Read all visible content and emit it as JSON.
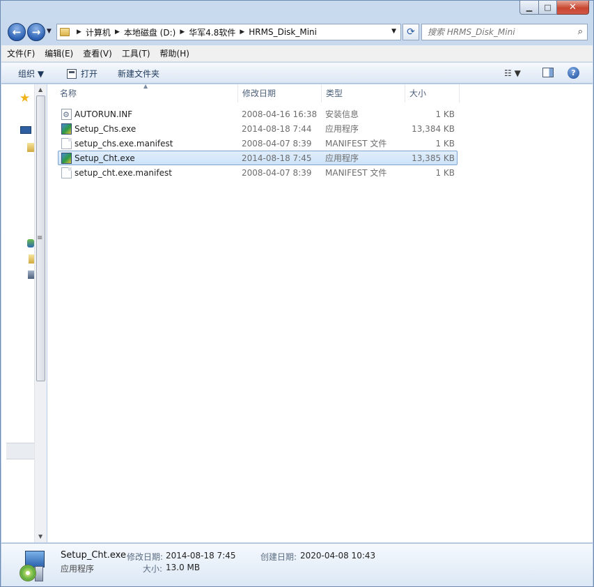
{
  "window": {
    "controls": {
      "minimize": "▁",
      "maximize": "□",
      "close": "✕"
    }
  },
  "navigation": {
    "back_icon": "←",
    "forward_icon": "→",
    "history_dropdown": "▼",
    "breadcrumb": [
      "计算机",
      "本地磁盘 (D:)",
      "华军4.8软件",
      "HRMS_Disk_Mini"
    ],
    "refresh_icon": "⟳",
    "search_placeholder": "搜索 HRMS_Disk_Mini"
  },
  "menubar": {
    "items": [
      "文件(F)",
      "编辑(E)",
      "查看(V)",
      "工具(T)",
      "帮助(H)"
    ]
  },
  "commandbar": {
    "organize": "组织 ▼",
    "open": "打开",
    "new_folder": "新建文件夹",
    "view_label": "☷ ▼",
    "help": "?"
  },
  "columns": {
    "name": "名称",
    "date": "修改日期",
    "type": "类型",
    "size": "大小",
    "sort_arrow": "▲"
  },
  "files": [
    {
      "name": "AUTORUN.INF",
      "date": "2008-04-16 16:38",
      "type": "安装信息",
      "size": "1 KB",
      "icon": "inf-settings-icon",
      "selected": false
    },
    {
      "name": "Setup_Chs.exe",
      "date": "2014-08-18 7:44",
      "type": "应用程序",
      "size": "13,384 KB",
      "icon": "setup-exe-icon",
      "selected": false
    },
    {
      "name": "setup_chs.exe.manifest",
      "date": "2008-04-07 8:39",
      "type": "MANIFEST 文件",
      "size": "1 KB",
      "icon": "document-icon",
      "selected": false
    },
    {
      "name": "Setup_Cht.exe",
      "date": "2014-08-18 7:45",
      "type": "应用程序",
      "size": "13,385 KB",
      "icon": "setup-exe-icon",
      "selected": true
    },
    {
      "name": "setup_cht.exe.manifest",
      "date": "2008-04-07 8:39",
      "type": "MANIFEST 文件",
      "size": "1 KB",
      "icon": "document-icon",
      "selected": false
    }
  ],
  "details": {
    "name": "Setup_Cht.exe",
    "type": "应用程序",
    "modified_label": "修改日期:",
    "modified_value": "2014-08-18 7:45",
    "size_label": "大小:",
    "size_value": "13.0 MB",
    "created_label": "创建日期:",
    "created_value": "2020-04-08 10:43"
  },
  "colors": {
    "selection": "#cde3fa",
    "selection_border": "#7da2ce",
    "chrome": "#bcd0ea"
  }
}
